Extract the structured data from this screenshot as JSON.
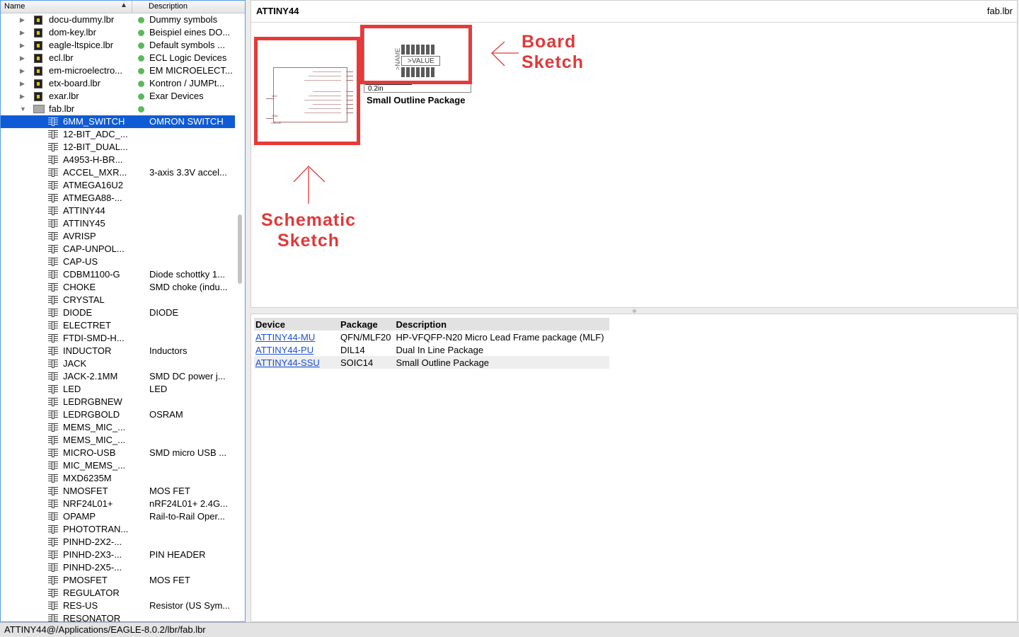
{
  "tree": {
    "header": {
      "name": "Name",
      "description": "Description"
    },
    "libraries": [
      {
        "name": "docu-dummy.lbr",
        "description": "Dummy symbols"
      },
      {
        "name": "dom-key.lbr",
        "description": "Beispiel eines DO..."
      },
      {
        "name": "eagle-ltspice.lbr",
        "description": "Default symbols ..."
      },
      {
        "name": "ecl.lbr",
        "description": "ECL Logic Devices"
      },
      {
        "name": "em-microelectro...",
        "description": "EM MICROELECT..."
      },
      {
        "name": "etx-board.lbr",
        "description": "Kontron / JUMPt..."
      },
      {
        "name": "exar.lbr",
        "description": "Exar Devices"
      },
      {
        "name": "fab.lbr",
        "description": ""
      }
    ],
    "devices": [
      {
        "name": "6MM_SWITCH",
        "description": "OMRON SWITCH",
        "selected": true
      },
      {
        "name": "12-BIT_ADC_...",
        "description": ""
      },
      {
        "name": "12-BIT_DUAL...",
        "description": ""
      },
      {
        "name": "A4953-H-BR...",
        "description": ""
      },
      {
        "name": "ACCEL_MXR...",
        "description": "3-axis 3.3V accel..."
      },
      {
        "name": "ATMEGA16U2",
        "description": ""
      },
      {
        "name": "ATMEGA88-...",
        "description": ""
      },
      {
        "name": "ATTINY44",
        "description": ""
      },
      {
        "name": "ATTINY45",
        "description": ""
      },
      {
        "name": "AVRISP",
        "description": ""
      },
      {
        "name": "CAP-UNPOL...",
        "description": ""
      },
      {
        "name": "CAP-US",
        "description": ""
      },
      {
        "name": "CDBM1100-G",
        "description": "Diode schottky 1..."
      },
      {
        "name": "CHOKE",
        "description": "SMD choke (indu..."
      },
      {
        "name": "CRYSTAL",
        "description": ""
      },
      {
        "name": "DIODE",
        "description": "DIODE"
      },
      {
        "name": "ELECTRET",
        "description": ""
      },
      {
        "name": "FTDI-SMD-H...",
        "description": ""
      },
      {
        "name": "INDUCTOR",
        "description": "Inductors"
      },
      {
        "name": "JACK",
        "description": ""
      },
      {
        "name": "JACK-2.1MM",
        "description": "SMD DC power j..."
      },
      {
        "name": "LED",
        "description": "LED"
      },
      {
        "name": "LEDRGBNEW",
        "description": ""
      },
      {
        "name": "LEDRGBOLD",
        "description": "OSRAM"
      },
      {
        "name": "MEMS_MIC_...",
        "description": ""
      },
      {
        "name": "MEMS_MIC_...",
        "description": ""
      },
      {
        "name": "MICRO-USB",
        "description": "SMD micro USB ..."
      },
      {
        "name": "MIC_MEMS_...",
        "description": ""
      },
      {
        "name": "MXD6235M",
        "description": ""
      },
      {
        "name": "NMOSFET",
        "description": "MOS FET"
      },
      {
        "name": "NRF24L01+",
        "description": "nRF24L01+ 2.4G..."
      },
      {
        "name": "OPAMP",
        "description": "Rail-to-Rail Oper..."
      },
      {
        "name": "PHOTOTRAN...",
        "description": ""
      },
      {
        "name": "PINHD-2X2-...",
        "description": ""
      },
      {
        "name": "PINHD-2X3-...",
        "description": "PIN HEADER"
      },
      {
        "name": "PINHD-2X5-...",
        "description": ""
      },
      {
        "name": "PMOSFET",
        "description": "MOS FET"
      },
      {
        "name": "REGULATOR",
        "description": ""
      },
      {
        "name": "RES-US",
        "description": "Resistor (US Sym..."
      },
      {
        "name": "RESONATOR",
        "description": ""
      }
    ]
  },
  "preview": {
    "device_title": "ATTINY44",
    "library_name": "fab.lbr",
    "package_caption": "Small Outline Package",
    "scale_label": "0.2in",
    "pkg_name_label": ">NAME",
    "pkg_value_label": ">VALUE",
    "schem_value_label": ">VALUE",
    "schem_vcc_label": "VCC",
    "schem_gnd_label": "GND",
    "annotation_board": [
      "Board",
      "Sketch"
    ],
    "annotation_schematic": [
      "Schematic",
      "Sketch"
    ],
    "annotation_color": "#e0393a"
  },
  "device_table": {
    "columns": [
      "Device",
      "Package",
      "Description"
    ],
    "rows": [
      {
        "device": "ATTINY44-MU",
        "package": "QFN/MLF20",
        "description": "HP-VFQFP-N20 Micro Lead Frame package (MLF)"
      },
      {
        "device": "ATTINY44-PU",
        "package": "DIL14",
        "description": "Dual In Line Package"
      },
      {
        "device": "ATTINY44-SSU",
        "package": "SOIC14",
        "description": "Small Outline Package"
      }
    ]
  },
  "status_bar": {
    "path": "ATTINY44@/Applications/EAGLE-8.0.2/lbr/fab.lbr"
  }
}
